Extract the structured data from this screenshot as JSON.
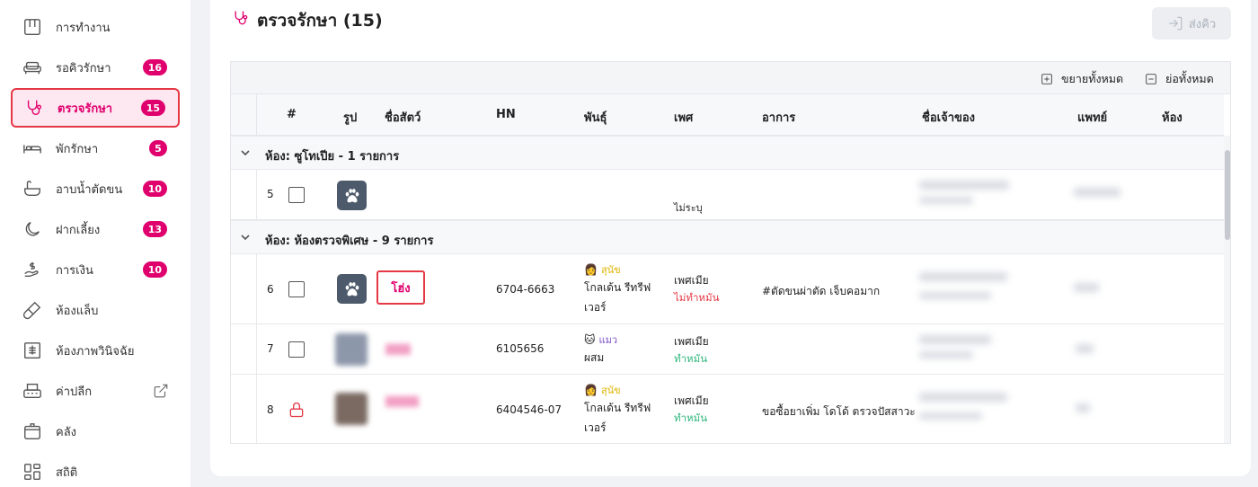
{
  "sidebar": {
    "items": [
      {
        "label": "การทำงาน",
        "icon": "grid-icon"
      },
      {
        "label": "รอคิวรักษา",
        "badge": "16",
        "icon": "sofa-icon"
      },
      {
        "label": "ตรวจรักษา",
        "badge": "15",
        "icon": "stethoscope-icon",
        "active": true
      },
      {
        "label": "พักรักษา",
        "badge": "5",
        "icon": "bed-icon"
      },
      {
        "label": "อาบน้ำตัดขน",
        "badge": "10",
        "icon": "bathtub-icon"
      },
      {
        "label": "ฝากเลี้ยง",
        "badge": "13",
        "icon": "moon-icon"
      },
      {
        "label": "การเงิน",
        "badge": "10",
        "icon": "money-hand-icon"
      },
      {
        "label": "ห้องแล็บ",
        "icon": "test-tube-icon"
      },
      {
        "label": "ห้องภาพวินิจฉัย",
        "icon": "xray-icon"
      },
      {
        "label": "ค่าปลีก",
        "icon": "register-icon"
      },
      {
        "label": "คลัง",
        "icon": "box-icon"
      },
      {
        "label": "สถิติ",
        "icon": "dashboard-icon"
      }
    ]
  },
  "header": {
    "title": "ตรวจรักษา (15)",
    "send_label": "ส่งคิว"
  },
  "toolbar": {
    "expand_all": "ขยายทั้งหมด",
    "collapse_all": "ย่อทั้งหมด"
  },
  "table": {
    "columns": [
      "#",
      "รูป",
      "ชื่อสัตว์",
      "HN",
      "พันธุ์",
      "เพศ",
      "อาการ",
      "ชื่อเจ้าของ",
      "แพทย์",
      "ห้อง"
    ],
    "groups": [
      {
        "label": "ห้อง: ซูโทเปีย - 1 รายการ"
      },
      {
        "label": "ห้อง: ห้องตรวจพิเศษ - 9 รายการ"
      }
    ],
    "rows": [
      {
        "num": "5",
        "pet": "",
        "hn": "",
        "species": "",
        "breed": "",
        "sex": "",
        "sex_sub": "ไม่ระบุ",
        "symptom": ""
      },
      {
        "num": "6",
        "pet": "โฮ่ง",
        "hn": "6704-6663",
        "species": "สุนัข",
        "breed_1": "โกลเด้น รีทรีฟ",
        "breed_2": "เวอร์",
        "sex": "เพศเมีย",
        "sex_sub": "ไม่ทำหมัน",
        "symptom": "#ตัดขนผ่าตัด เจ็บคอมาก"
      },
      {
        "num": "7",
        "pet": "",
        "hn": "6105656",
        "species": "แมว",
        "breed_1": "ผสม",
        "sex": "เพศเมีย",
        "sex_sub": "ทำหมัน",
        "symptom": ""
      },
      {
        "num": "8",
        "pet": "",
        "hn": "6404546-07",
        "species": "สุนัข",
        "breed_1": "โกลเด้น รีทรีฟ",
        "breed_2": "เวอร์",
        "sex": "เพศเมีย",
        "sex_sub": "ทำหมัน",
        "symptom": "ขอซื้อยาเพิ่ม โดโด้ ตรวจปัสสาวะ"
      }
    ]
  },
  "colors": {
    "accent": "#e0006d",
    "highlight": "#e53945",
    "green": "#2db67c"
  }
}
